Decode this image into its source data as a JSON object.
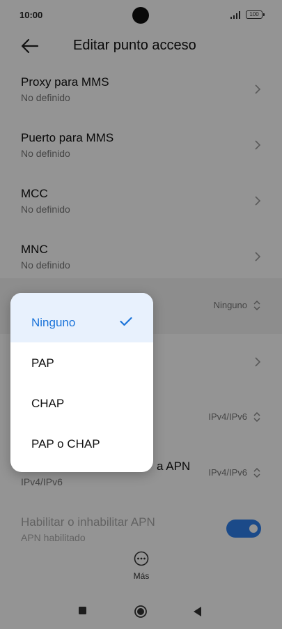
{
  "status": {
    "time": "10:00",
    "battery": "100"
  },
  "header": {
    "title": "Editar punto acceso"
  },
  "rows": [
    {
      "title": "Proxy para MMS",
      "subtitle": "No definido"
    },
    {
      "title": "Puerto para MMS",
      "subtitle": "No definido"
    },
    {
      "title": "MCC",
      "subtitle": "No definido"
    },
    {
      "title": "MNC",
      "subtitle": "No definido"
    }
  ],
  "auth_row": {
    "value": "Ninguno"
  },
  "protocol_row": {
    "value": "IPv4/IPv6"
  },
  "roaming_row": {
    "title_fragment": "a APN",
    "subtitle": "IPv4/IPv6",
    "value": "IPv4/IPv6"
  },
  "apn_toggle_row": {
    "title": "Habilitar o inhabilitar APN",
    "subtitle": "APN habilitado",
    "enabled": true
  },
  "more": {
    "label": "Más"
  },
  "popup": {
    "options": [
      {
        "label": "Ninguno",
        "selected": true
      },
      {
        "label": "PAP",
        "selected": false
      },
      {
        "label": "CHAP",
        "selected": false
      },
      {
        "label": "PAP o CHAP",
        "selected": false
      }
    ]
  },
  "colors": {
    "accent": "#1a73d9",
    "toggle": "#2f80ed"
  }
}
